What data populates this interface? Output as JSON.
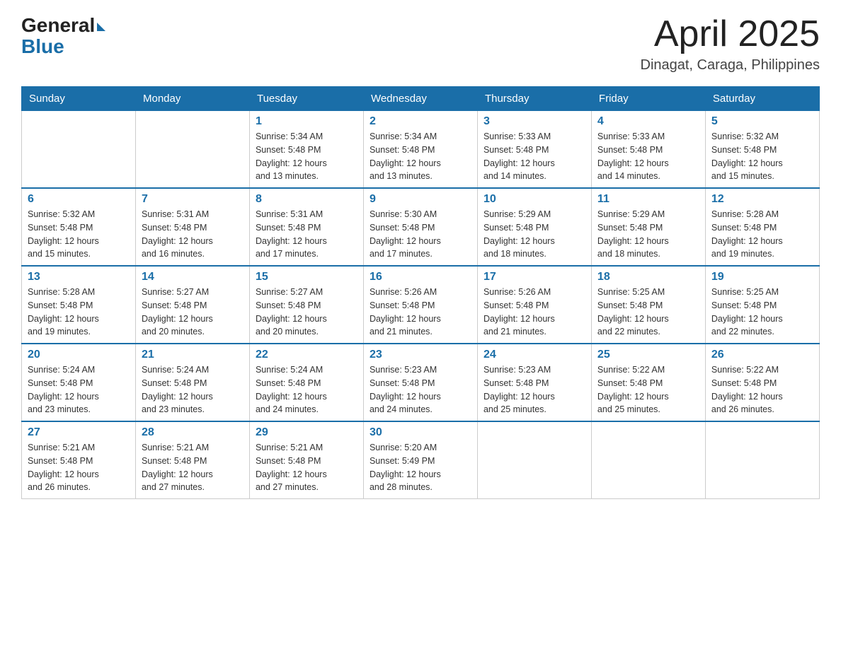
{
  "header": {
    "logo": {
      "general": "General",
      "blue": "Blue",
      "tagline": "Blue"
    },
    "title": "April 2025",
    "location": "Dinagat, Caraga, Philippines"
  },
  "weekdays": [
    "Sunday",
    "Monday",
    "Tuesday",
    "Wednesday",
    "Thursday",
    "Friday",
    "Saturday"
  ],
  "weeks": [
    [
      {
        "day": "",
        "info": ""
      },
      {
        "day": "",
        "info": ""
      },
      {
        "day": "1",
        "info": "Sunrise: 5:34 AM\nSunset: 5:48 PM\nDaylight: 12 hours\nand 13 minutes."
      },
      {
        "day": "2",
        "info": "Sunrise: 5:34 AM\nSunset: 5:48 PM\nDaylight: 12 hours\nand 13 minutes."
      },
      {
        "day": "3",
        "info": "Sunrise: 5:33 AM\nSunset: 5:48 PM\nDaylight: 12 hours\nand 14 minutes."
      },
      {
        "day": "4",
        "info": "Sunrise: 5:33 AM\nSunset: 5:48 PM\nDaylight: 12 hours\nand 14 minutes."
      },
      {
        "day": "5",
        "info": "Sunrise: 5:32 AM\nSunset: 5:48 PM\nDaylight: 12 hours\nand 15 minutes."
      }
    ],
    [
      {
        "day": "6",
        "info": "Sunrise: 5:32 AM\nSunset: 5:48 PM\nDaylight: 12 hours\nand 15 minutes."
      },
      {
        "day": "7",
        "info": "Sunrise: 5:31 AM\nSunset: 5:48 PM\nDaylight: 12 hours\nand 16 minutes."
      },
      {
        "day": "8",
        "info": "Sunrise: 5:31 AM\nSunset: 5:48 PM\nDaylight: 12 hours\nand 17 minutes."
      },
      {
        "day": "9",
        "info": "Sunrise: 5:30 AM\nSunset: 5:48 PM\nDaylight: 12 hours\nand 17 minutes."
      },
      {
        "day": "10",
        "info": "Sunrise: 5:29 AM\nSunset: 5:48 PM\nDaylight: 12 hours\nand 18 minutes."
      },
      {
        "day": "11",
        "info": "Sunrise: 5:29 AM\nSunset: 5:48 PM\nDaylight: 12 hours\nand 18 minutes."
      },
      {
        "day": "12",
        "info": "Sunrise: 5:28 AM\nSunset: 5:48 PM\nDaylight: 12 hours\nand 19 minutes."
      }
    ],
    [
      {
        "day": "13",
        "info": "Sunrise: 5:28 AM\nSunset: 5:48 PM\nDaylight: 12 hours\nand 19 minutes."
      },
      {
        "day": "14",
        "info": "Sunrise: 5:27 AM\nSunset: 5:48 PM\nDaylight: 12 hours\nand 20 minutes."
      },
      {
        "day": "15",
        "info": "Sunrise: 5:27 AM\nSunset: 5:48 PM\nDaylight: 12 hours\nand 20 minutes."
      },
      {
        "day": "16",
        "info": "Sunrise: 5:26 AM\nSunset: 5:48 PM\nDaylight: 12 hours\nand 21 minutes."
      },
      {
        "day": "17",
        "info": "Sunrise: 5:26 AM\nSunset: 5:48 PM\nDaylight: 12 hours\nand 21 minutes."
      },
      {
        "day": "18",
        "info": "Sunrise: 5:25 AM\nSunset: 5:48 PM\nDaylight: 12 hours\nand 22 minutes."
      },
      {
        "day": "19",
        "info": "Sunrise: 5:25 AM\nSunset: 5:48 PM\nDaylight: 12 hours\nand 22 minutes."
      }
    ],
    [
      {
        "day": "20",
        "info": "Sunrise: 5:24 AM\nSunset: 5:48 PM\nDaylight: 12 hours\nand 23 minutes."
      },
      {
        "day": "21",
        "info": "Sunrise: 5:24 AM\nSunset: 5:48 PM\nDaylight: 12 hours\nand 23 minutes."
      },
      {
        "day": "22",
        "info": "Sunrise: 5:24 AM\nSunset: 5:48 PM\nDaylight: 12 hours\nand 24 minutes."
      },
      {
        "day": "23",
        "info": "Sunrise: 5:23 AM\nSunset: 5:48 PM\nDaylight: 12 hours\nand 24 minutes."
      },
      {
        "day": "24",
        "info": "Sunrise: 5:23 AM\nSunset: 5:48 PM\nDaylight: 12 hours\nand 25 minutes."
      },
      {
        "day": "25",
        "info": "Sunrise: 5:22 AM\nSunset: 5:48 PM\nDaylight: 12 hours\nand 25 minutes."
      },
      {
        "day": "26",
        "info": "Sunrise: 5:22 AM\nSunset: 5:48 PM\nDaylight: 12 hours\nand 26 minutes."
      }
    ],
    [
      {
        "day": "27",
        "info": "Sunrise: 5:21 AM\nSunset: 5:48 PM\nDaylight: 12 hours\nand 26 minutes."
      },
      {
        "day": "28",
        "info": "Sunrise: 5:21 AM\nSunset: 5:48 PM\nDaylight: 12 hours\nand 27 minutes."
      },
      {
        "day": "29",
        "info": "Sunrise: 5:21 AM\nSunset: 5:48 PM\nDaylight: 12 hours\nand 27 minutes."
      },
      {
        "day": "30",
        "info": "Sunrise: 5:20 AM\nSunset: 5:49 PM\nDaylight: 12 hours\nand 28 minutes."
      },
      {
        "day": "",
        "info": ""
      },
      {
        "day": "",
        "info": ""
      },
      {
        "day": "",
        "info": ""
      }
    ]
  ]
}
